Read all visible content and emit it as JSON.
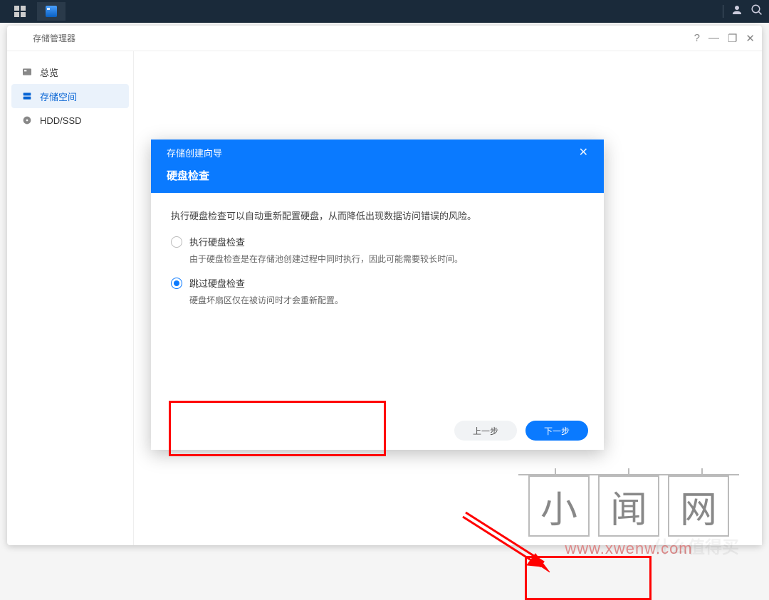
{
  "topbar": {},
  "window": {
    "title": "存储管理器",
    "sysbuttons": {
      "help": "?",
      "min": "—",
      "max": "❐",
      "close": "✕"
    }
  },
  "sidebar": {
    "items": [
      {
        "label": "总览"
      },
      {
        "label": "存储空间"
      },
      {
        "label": "HDD/SSD"
      }
    ]
  },
  "modal": {
    "breadcrumb": "存储创建向导",
    "title": "硬盘检查",
    "close": "✕",
    "desc": "执行硬盘检查可以自动重新配置硬盘，从而降低出现数据访问错误的风险。",
    "options": [
      {
        "label": "执行硬盘检查",
        "sub": "由于硬盘检查是在存储池创建过程中同时执行，因此可能需要较长时间。",
        "selected": false
      },
      {
        "label": "跳过硬盘检查",
        "sub": "硬盘坏扇区仅在被访问时才会重新配置。",
        "selected": true
      }
    ],
    "buttons": {
      "prev": "上一步",
      "next": "下一步"
    }
  },
  "watermark": {
    "chars": [
      "小",
      "闻",
      "网"
    ],
    "url": "www.xwenw.com",
    "faint": "什么值得买"
  }
}
